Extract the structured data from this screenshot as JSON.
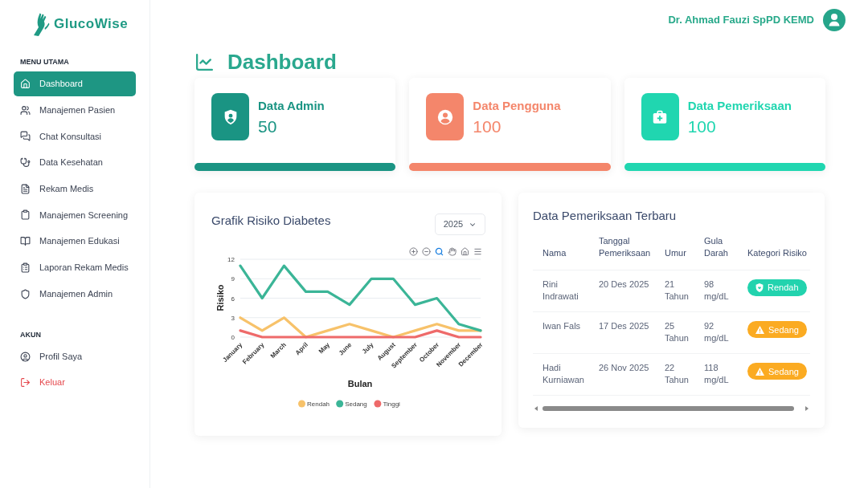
{
  "sidebar": {
    "brand": "GlucoWise",
    "sections": [
      {
        "title": "MENU UTAMA",
        "items": [
          {
            "label": "Dashboard",
            "selected": true,
            "kind": "normal"
          },
          {
            "label": "Manajemen Pasien",
            "selected": false,
            "kind": "normal"
          },
          {
            "label": "Chat Konsultasi",
            "selected": false,
            "kind": "normal"
          },
          {
            "label": "Data Kesehatan",
            "selected": false,
            "kind": "normal"
          },
          {
            "label": "Rekam Medis",
            "selected": false,
            "kind": "normal"
          },
          {
            "label": "Manajemen Screening",
            "selected": false,
            "kind": "normal"
          },
          {
            "label": "Manajemen Edukasi",
            "selected": false,
            "kind": "normal"
          },
          {
            "label": "Laporan Rekam Medis",
            "selected": false,
            "kind": "normal"
          },
          {
            "label": "Manajemen Admin",
            "selected": false,
            "kind": "normal"
          }
        ]
      },
      {
        "title": "AKUN",
        "items": [
          {
            "label": "Profil Saya",
            "selected": false,
            "kind": "normal"
          },
          {
            "label": "Keluar",
            "selected": false,
            "kind": "logout"
          }
        ]
      }
    ]
  },
  "header": {
    "user_name": "Dr. Ahmad Fauzi SpPD KEMD"
  },
  "page_title": "Dashboard",
  "stat_cards": [
    {
      "title": "Data Admin",
      "value": "50",
      "color": "#1a9483",
      "kind": "shield"
    },
    {
      "title": "Data Pengguna",
      "value": "100",
      "color": "#f4866b",
      "kind": "person"
    },
    {
      "title": "Data Pemeriksaan",
      "value": "100",
      "color": "#20d6b0",
      "kind": "kit"
    }
  ],
  "risk_chart": {
    "title": "Grafik Risiko Diabetes",
    "year_select": {
      "value": "2025"
    },
    "tools": [
      {
        "kind": "zoom-in",
        "selected": false
      },
      {
        "kind": "zoom-out",
        "selected": false
      },
      {
        "kind": "zoom",
        "selected": true
      },
      {
        "kind": "pan",
        "selected": false
      },
      {
        "kind": "reset",
        "selected": false
      },
      {
        "kind": "menu",
        "selected": false
      }
    ],
    "chart_data": {
      "type": "line",
      "xlabel": "Bulan",
      "ylabel": "Risiko",
      "categories": [
        "January",
        "February",
        "March",
        "April",
        "May",
        "June",
        "July",
        "August",
        "September",
        "October",
        "November",
        "December"
      ],
      "series": [
        {
          "name": "Rendah",
          "color": "#f7c26a",
          "values": [
            3,
            1,
            3,
            0,
            1,
            2,
            1,
            0,
            1,
            2,
            1,
            1
          ]
        },
        {
          "name": "Sedang",
          "color": "#3bb597",
          "values": [
            11,
            6,
            11,
            7,
            7,
            5,
            9,
            9,
            5,
            6,
            2,
            1
          ]
        },
        {
          "name": "Tinggi",
          "color": "#ee6a6a",
          "values": [
            1,
            0,
            0,
            0,
            0,
            0,
            0,
            0,
            0,
            1,
            0,
            0
          ]
        }
      ],
      "ylim": [
        0,
        12
      ],
      "yticks": [
        0,
        3,
        6,
        9,
        12
      ],
      "grid": true,
      "legend": "bottom"
    }
  },
  "latest_exams": {
    "title": "Data Pemeriksaan Terbaru",
    "columns": [
      "Nama",
      "Tanggal Pemeriksaan",
      "Umur",
      "Gula Darah",
      "Kategori Risiko"
    ],
    "rows": [
      {
        "cells": [
          "Rini Indrawati",
          "20 Des 2025",
          "21 Tahun",
          "98 mg/dL"
        ],
        "risk": {
          "label": "Rendah",
          "kind": "low",
          "color": "#22d3ae"
        }
      },
      {
        "cells": [
          "Iwan Fals",
          "17 Des 2025",
          "25 Tahun",
          "92 mg/dL"
        ],
        "risk": {
          "label": "Sedang",
          "kind": "medium",
          "color": "#fbab22"
        }
      },
      {
        "cells": [
          "Hadi Kurniawan",
          "26 Nov 2025",
          "22 Tahun",
          "118 mg/dL"
        ],
        "risk": {
          "label": "Sedang",
          "kind": "medium",
          "color": "#fbab22"
        }
      }
    ]
  }
}
